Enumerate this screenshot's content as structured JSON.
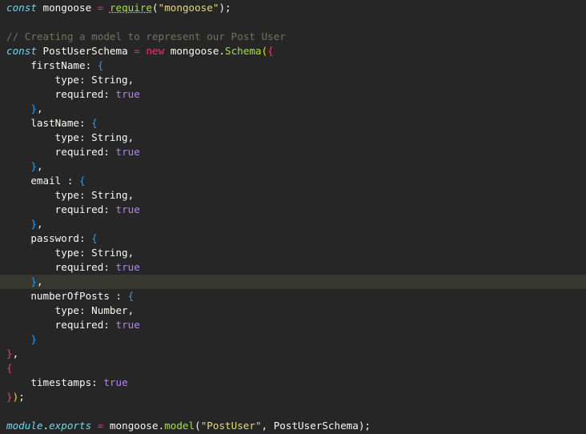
{
  "editor": {
    "lines": [
      [
        {
          "t": "const",
          "c": "kw-italic"
        },
        {
          "t": " mongoose ",
          "c": "plain"
        },
        {
          "t": "=",
          "c": "op"
        },
        {
          "t": " ",
          "c": "plain"
        },
        {
          "t": "require",
          "c": "fn warn"
        },
        {
          "t": "(",
          "c": "plain"
        },
        {
          "t": "\"mongoose\"",
          "c": "str"
        },
        {
          "t": ");",
          "c": "plain"
        }
      ],
      [],
      [
        {
          "t": "// Creating a model to represent our Post User",
          "c": "comment"
        }
      ],
      [
        {
          "t": "const",
          "c": "kw-italic"
        },
        {
          "t": " PostUserSchema ",
          "c": "plain"
        },
        {
          "t": "=",
          "c": "op"
        },
        {
          "t": " ",
          "c": "plain"
        },
        {
          "t": "new",
          "c": "kw-new"
        },
        {
          "t": " mongoose.",
          "c": "plain"
        },
        {
          "t": "Schema",
          "c": "fn"
        },
        {
          "t": "(",
          "c": "b1"
        },
        {
          "t": "{",
          "c": "b1m"
        }
      ],
      [
        {
          "t": "    firstName: ",
          "c": "plain"
        },
        {
          "t": "{",
          "c": "b3"
        }
      ],
      [
        {
          "t": "        type: String,",
          "c": "plain"
        }
      ],
      [
        {
          "t": "        required: ",
          "c": "plain"
        },
        {
          "t": "true",
          "c": "bool"
        }
      ],
      [
        {
          "t": "    ",
          "c": "plain"
        },
        {
          "t": "}",
          "c": "b3"
        },
        {
          "t": ",",
          "c": "plain"
        }
      ],
      [
        {
          "t": "    lastName: ",
          "c": "plain"
        },
        {
          "t": "{",
          "c": "b3"
        }
      ],
      [
        {
          "t": "        type: String,",
          "c": "plain"
        }
      ],
      [
        {
          "t": "        required: ",
          "c": "plain"
        },
        {
          "t": "true",
          "c": "bool"
        }
      ],
      [
        {
          "t": "    ",
          "c": "plain"
        },
        {
          "t": "}",
          "c": "b3"
        },
        {
          "t": ",",
          "c": "plain"
        }
      ],
      [
        {
          "t": "    email : ",
          "c": "plain"
        },
        {
          "t": "{",
          "c": "b3"
        }
      ],
      [
        {
          "t": "        type: String,",
          "c": "plain"
        }
      ],
      [
        {
          "t": "        required: ",
          "c": "plain"
        },
        {
          "t": "true",
          "c": "bool"
        }
      ],
      [
        {
          "t": "    ",
          "c": "plain"
        },
        {
          "t": "}",
          "c": "b3"
        },
        {
          "t": ",",
          "c": "plain"
        }
      ],
      [
        {
          "t": "    password: ",
          "c": "plain"
        },
        {
          "t": "{",
          "c": "b3"
        }
      ],
      [
        {
          "t": "        type: String,",
          "c": "plain"
        }
      ],
      [
        {
          "t": "        required: ",
          "c": "plain"
        },
        {
          "t": "true",
          "c": "bool"
        }
      ],
      [
        {
          "t": "    ",
          "c": "plain"
        },
        {
          "t": "}",
          "c": "b3"
        },
        {
          "t": ",",
          "c": "plain"
        }
      ],
      [
        {
          "t": "    numberOfPosts : ",
          "c": "plain"
        },
        {
          "t": "{",
          "c": "b3"
        }
      ],
      [
        {
          "t": "        type: Number,",
          "c": "plain"
        }
      ],
      [
        {
          "t": "        required: ",
          "c": "plain"
        },
        {
          "t": "true",
          "c": "bool"
        }
      ],
      [
        {
          "t": "    ",
          "c": "plain"
        },
        {
          "t": "}",
          "c": "b3"
        }
      ],
      [
        {
          "t": "}",
          "c": "b1m"
        },
        {
          "t": ",",
          "c": "plain"
        }
      ],
      [
        {
          "t": "{",
          "c": "b1m"
        }
      ],
      [
        {
          "t": "    timestamps: ",
          "c": "plain"
        },
        {
          "t": "true",
          "c": "bool"
        }
      ],
      [
        {
          "t": "}",
          "c": "b1m"
        },
        {
          "t": ")",
          "c": "b1"
        },
        {
          "t": ";",
          "c": "plain"
        }
      ],
      [],
      [
        {
          "t": "module",
          "c": "kw-italic"
        },
        {
          "t": ".",
          "c": "plain"
        },
        {
          "t": "exports",
          "c": "kw-italic"
        },
        {
          "t": " ",
          "c": "plain"
        },
        {
          "t": "=",
          "c": "op"
        },
        {
          "t": " mongoose.",
          "c": "plain"
        },
        {
          "t": "model",
          "c": "fn"
        },
        {
          "t": "(",
          "c": "plain"
        },
        {
          "t": "\"PostUser\"",
          "c": "str"
        },
        {
          "t": ", PostUserSchema);",
          "c": "plain"
        }
      ]
    ],
    "current_line_index": 19,
    "colors": {
      "background": "#262626",
      "current_line": "#36372e",
      "keyword": "#66d9ef",
      "function": "#a6e22e",
      "string": "#e6db74",
      "boolean": "#ae81ff",
      "comment": "#75715e",
      "operator": "#f92672"
    }
  }
}
